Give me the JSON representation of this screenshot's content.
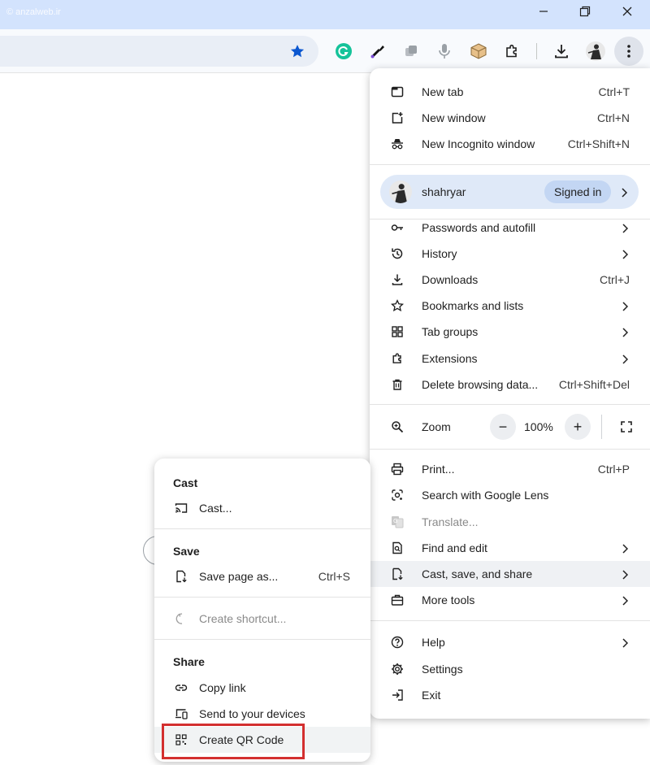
{
  "watermark": "© anzalweb.ir",
  "window_controls": [
    "minimize-icon",
    "restore-icon",
    "close-icon"
  ],
  "toolbar_icons": [
    "bookmark-star-icon",
    "grammarly-icon",
    "eyedropper-icon",
    "extension-icon",
    "microphone-icon",
    "box-icon",
    "extensions-puzzle-icon",
    "downloads-icon",
    "profile-avatar",
    "more-menu-icon"
  ],
  "menu": {
    "new_tab": {
      "label": "New tab",
      "shortcut": "Ctrl+T"
    },
    "new_window": {
      "label": "New window",
      "shortcut": "Ctrl+N"
    },
    "new_incognito": {
      "label": "New Incognito window",
      "shortcut": "Ctrl+Shift+N"
    },
    "profile": {
      "name": "shahryar",
      "status": "Signed in"
    },
    "passwords": {
      "label": "Passwords and autofill"
    },
    "history": {
      "label": "History"
    },
    "downloads": {
      "label": "Downloads",
      "shortcut": "Ctrl+J"
    },
    "bookmarks": {
      "label": "Bookmarks and lists"
    },
    "tab_groups": {
      "label": "Tab groups"
    },
    "extensions": {
      "label": "Extensions"
    },
    "delete_data": {
      "label": "Delete browsing data...",
      "shortcut": "Ctrl+Shift+Del"
    },
    "zoom": {
      "label": "Zoom",
      "minus": "−",
      "value": "100%",
      "plus": "+"
    },
    "print": {
      "label": "Print...",
      "shortcut": "Ctrl+P"
    },
    "lens": {
      "label": "Search with Google Lens"
    },
    "translate": {
      "label": "Translate..."
    },
    "find_edit": {
      "label": "Find and edit"
    },
    "cast_save_share": {
      "label": "Cast, save, and share"
    },
    "more_tools": {
      "label": "More tools"
    },
    "help": {
      "label": "Help"
    },
    "settings": {
      "label": "Settings"
    },
    "exit": {
      "label": "Exit"
    }
  },
  "submenu": {
    "cast_header": "Cast",
    "cast": "Cast...",
    "save_header": "Save",
    "save_page": {
      "label": "Save page as...",
      "shortcut": "Ctrl+S"
    },
    "create_shortcut": "Create shortcut...",
    "share_header": "Share",
    "copy_link": "Copy link",
    "send_devices": "Send to your devices",
    "qr_code": "Create QR Code"
  },
  "colors": {
    "titlebar": "#d3e3fd",
    "accent": "#0b57d0",
    "highlight_box": "#d32f2f"
  }
}
